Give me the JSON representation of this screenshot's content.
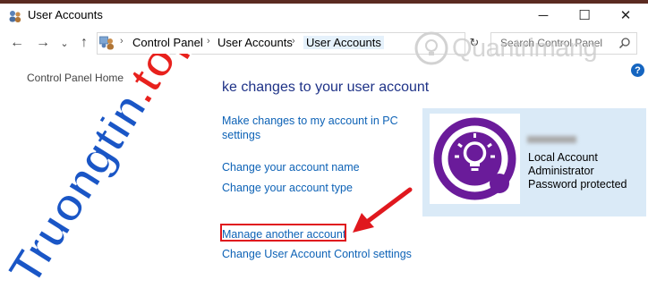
{
  "window": {
    "title": "User Accounts",
    "minimize": "─",
    "maximize": "☐",
    "close": "✕"
  },
  "nav": {
    "back": "←",
    "forward": "→",
    "dropdown": "⌄",
    "up": "↑",
    "breadcrumb": [
      "Control Panel",
      "User Accounts",
      "User Accounts"
    ],
    "search_placeholder": "Search Control Panel",
    "refresh": "↻"
  },
  "left_pane": {
    "label": "Control Panel Home"
  },
  "main": {
    "heading": "ke changes to your user account",
    "tasks": [
      "Make changes to my account in PC",
      "settings",
      "Change your account name",
      "Change your account type",
      "Manage another account",
      "Change User Account Control settings"
    ]
  },
  "account": {
    "lines": [
      "Local Account",
      "Administrator",
      "Password protected"
    ],
    "avatar_color": "#6a1b9a"
  },
  "help": {
    "label": "?"
  },
  "watermark": {
    "left": "Truongtin.top",
    "right": "Quantrimang",
    "left_color": "#1a56c6",
    "left_dot_color": "#e8211d"
  },
  "annotation_color": "#e0181e"
}
